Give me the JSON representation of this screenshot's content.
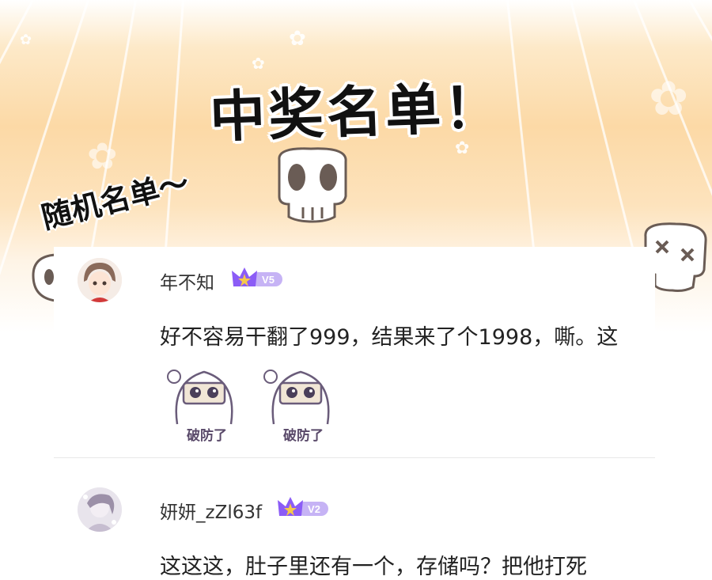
{
  "header": {
    "title": "中奖名单！",
    "subtitle": "随机名单～"
  },
  "comments": [
    {
      "username": "年不知",
      "level": "V5",
      "text": "好不容易干翻了999，结果来了个1998，嘶。这",
      "stickers": [
        {
          "caption": "破防了"
        },
        {
          "caption": "破防了"
        }
      ]
    },
    {
      "username": "妍妍_zZl63f",
      "level": "V2",
      "text": "这这这，肚子里还有一个，存储吗？把他打死"
    }
  ],
  "colors": {
    "background_top": "#fcd9a6",
    "badge_purple": "#8b5cf6",
    "badge_gold": "#f6c84a"
  }
}
